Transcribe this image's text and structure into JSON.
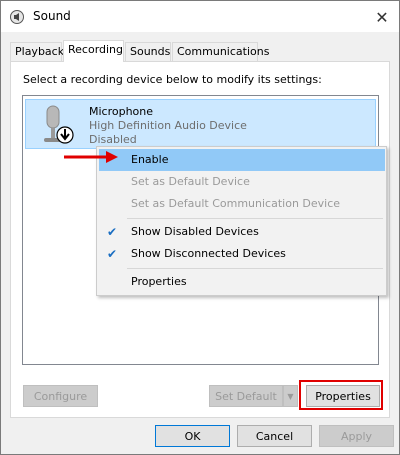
{
  "window": {
    "title": "Sound"
  },
  "tabs": [
    {
      "label": "Playback"
    },
    {
      "label": "Recording"
    },
    {
      "label": "Sounds"
    },
    {
      "label": "Communications"
    }
  ],
  "panel": {
    "instruction": "Select a recording device below to modify its settings:"
  },
  "device": {
    "name": "Microphone",
    "description": "High Definition Audio Device",
    "status": "Disabled"
  },
  "context_menu": {
    "items": [
      {
        "label": "Enable"
      },
      {
        "label": "Set as Default Device"
      },
      {
        "label": "Set as Default Communication Device"
      },
      {
        "label": "Show Disabled Devices"
      },
      {
        "label": "Show Disconnected Devices"
      },
      {
        "label": "Properties"
      }
    ]
  },
  "panel_buttons": {
    "configure": "Configure",
    "set_default": "Set Default",
    "properties": "Properties"
  },
  "dialog_buttons": {
    "ok": "OK",
    "cancel": "Cancel",
    "apply": "Apply"
  },
  "colors": {
    "selection": "#cce8ff",
    "menu_highlight": "#91c9f7",
    "annotation_red": "#e00000"
  }
}
